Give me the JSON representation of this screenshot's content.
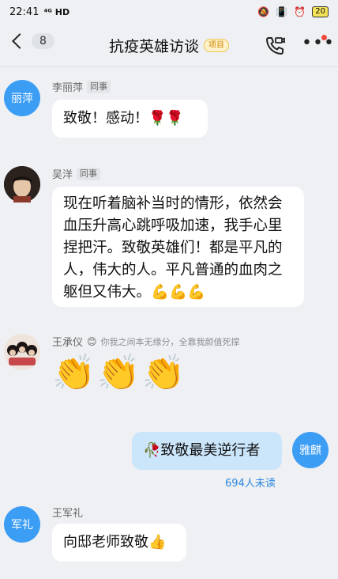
{
  "status_bar": {
    "time": "22:41",
    "network": "⁴ᴳ HD",
    "battery": "20"
  },
  "header": {
    "unread_count": "8",
    "title": "抗疫英雄访谈",
    "tag": "项目"
  },
  "messages": [
    {
      "avatar": "丽萍",
      "sender": "李丽萍",
      "role": "同事",
      "text": "致敬！感动！🌹🌹"
    },
    {
      "sender": "吴洋",
      "role": "同事",
      "text": "现在听着脑补当时的情形，依然会血压升高心跳呼吸加速，我手心里捏把汗。致敬英雄们！都是平凡的人，伟大的人。平凡普通的血肉之躯但又伟大。💪💪💪"
    },
    {
      "sender": "王承仪",
      "signature": "你我之间本无缘分，全靠我颜值死撑",
      "text": "👏👏👏"
    },
    {
      "avatar": "雅麒",
      "text": "🥀致敬最美逆行者",
      "read_status": "694人未读"
    },
    {
      "avatar": "军礼",
      "sender": "王军礼",
      "text": "向邸老师致敬👍"
    }
  ],
  "colors": {
    "accent": "#3c9df4",
    "self_bubble": "#cbe5fb",
    "background": "#eef0f3"
  }
}
